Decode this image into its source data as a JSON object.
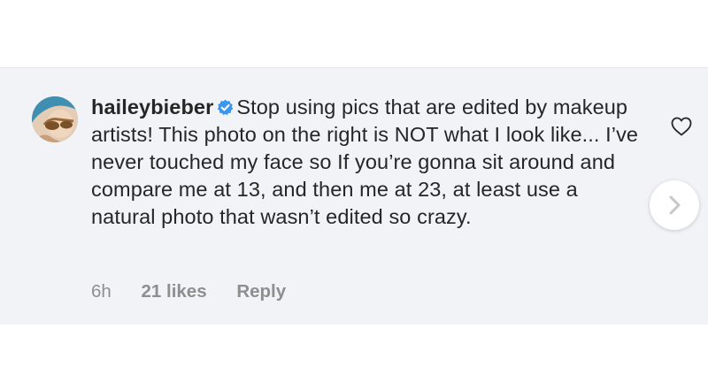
{
  "comment": {
    "username": "haileybieber",
    "verified_icon": "verified-check-icon",
    "text": "Stop using pics that are edited by makeup artists! This photo on the right is NOT what I look like... I’ve never touched my face so If you’re gonna sit around and compare me at 13, and then me at 23, at least use a natural photo that wasn’t edited so crazy.",
    "time": "6h",
    "likes": "21 likes",
    "reply_label": "Reply",
    "like_icon": "heart-outline-icon",
    "next_icon": "chevron-right-icon"
  },
  "colors": {
    "panel_background": "#f1f3f6",
    "text": "#262626",
    "meta_text": "#8e8e8e",
    "verified_blue": "#3897f0"
  }
}
